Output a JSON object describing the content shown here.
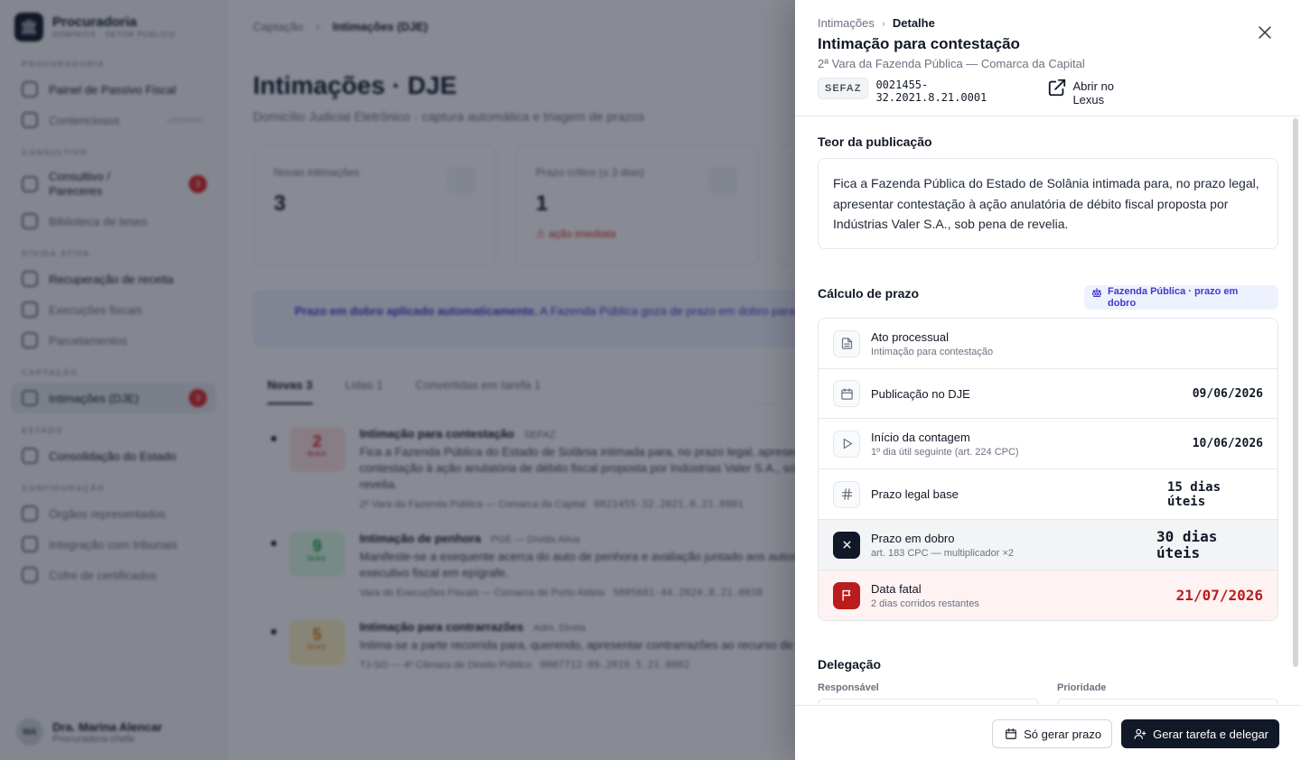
{
  "background": {
    "brand": {
      "title": "Procuradoria",
      "subtitle": "DOMÍNIOS · SETOR PÚBLICO"
    },
    "nav": {
      "procuradoria_label": "PROCURADORIA",
      "painel": "Painel de Passivo Fiscal",
      "contenciosos": "Contenciosos",
      "contenciosos_tag": "LEGADO",
      "consultivo_label": "CONSULTIVO",
      "consultivo": "Consultivo / Pareceres",
      "consultivo_badge": "3",
      "biblioteca": "Biblioteca de teses",
      "divida_label": "DÍVIDA ATIVA",
      "recuperacao": "Recuperação de receita",
      "execucoes": "Execuções fiscais",
      "parcelamentos": "Parcelamentos",
      "captacao_label": "CAPTAÇÃO",
      "intimacoes": "Intimações (DJE)",
      "intimacoes_badge": "3",
      "estado_label": "ESTADO",
      "consolidacao": "Consolidação do Estado",
      "config_label": "CONFIGURAÇÃO",
      "orgaos": "Órgãos representados",
      "integracao": "Integração com tribunais",
      "cofre": "Cofre de certificados"
    },
    "user": {
      "initials": "MA",
      "name": "Dra. Marina Alencar",
      "role": "Procuradora-chefe"
    },
    "breadcrumb": {
      "parent": "Captação",
      "current": "Intimações (DJE)"
    },
    "page_title": "Intimações · DJE",
    "page_subtitle": "Domicílio Judicial Eletrônico · captura automática e triagem de prazos",
    "cards": [
      {
        "label": "Novas intimações",
        "value": "3",
        "note": ""
      },
      {
        "label": "Prazo crítico (≤ 3 dias)",
        "value": "1",
        "note": "⚠ ação imediata"
      }
    ],
    "banner": {
      "strong": "Prazo em dobro aplicado automaticamente.",
      "text": "A Fazenda Pública goza de prazo em dobro para todas as suas manifestações processuais."
    },
    "tabs": [
      {
        "label": "Novas",
        "count": "3"
      },
      {
        "label": "Lidas",
        "count": "1"
      },
      {
        "label": "Convertidas em tarefa",
        "count": "1"
      }
    ],
    "rows": [
      {
        "days": "2",
        "unit": "DIAS",
        "title": "Intimação para contestação",
        "tag": "SEFAZ",
        "text": "Fica a Fazenda Pública do Estado de Solânia intimada para, no prazo legal, apresentar contestação à ação anulatória de débito fiscal proposta por Indústrias Valer S.A., sob pena de revelia.",
        "court": "2ª Vara da Fazenda Pública — Comarca da Capital",
        "number": "0021455-32.2021.8.21.0001",
        "color": "#fee2e2",
        "text_color": "#dc2626"
      },
      {
        "days": "9",
        "unit": "DIAS",
        "title": "Intimação de penhora",
        "tag": "PGE — Dívida Ativa",
        "text": "Manifeste-se a exequente acerca do auto de penhora e avaliação juntado aos autos do executivo fiscal em epígrafe.",
        "court": "Vara de Execuções Fiscais — Comarca de Porto Aldeia",
        "number": "5005601-44.2024.8.21.0038",
        "color": "#dcfce7",
        "text_color": "#16a34a"
      },
      {
        "days": "5",
        "unit": "DIAS",
        "title": "Intimação para contrarrazões",
        "tag": "Adm. Direta",
        "text": "Intima-se a parte recorrida para, querendo, apresentar contrarrazões ao recurso de apelação.",
        "court": "TJ-SO — 4ª Câmara de Direito Público",
        "number": "0007712-09.2019.5.21.0002",
        "color": "#fef3c7",
        "text_color": "#d97706"
      }
    ]
  },
  "drawer": {
    "breadcrumb": {
      "parent": "Intimações",
      "separator": "›",
      "current": "Detalhe"
    },
    "title": "Intimação para contestação",
    "subtitle": "2ª Vara da Fazenda Pública — Comarca da Capital",
    "chip": "SEFAZ",
    "process_number": "0021455-32.2021.8.21.0001",
    "open_lexus": "Abrir no Lexus",
    "teor": {
      "title": "Teor da publicação",
      "text": "Fica a Fazenda Pública do Estado de Solânia intimada para, no prazo legal, apresentar contestação à ação anulatória de débito fiscal proposta por Indústrias Valer S.A., sob pena de revelia."
    },
    "calc": {
      "title": "Cálculo de prazo",
      "pill": "Fazenda Pública · prazo em dobro",
      "rows": [
        {
          "icon": "document-icon",
          "label": "Ato processual",
          "note": "Intimação para contestação",
          "value": ""
        },
        {
          "icon": "calendar-icon",
          "label": "Publicação no DJE",
          "note": "",
          "value": "09/06/2026"
        },
        {
          "icon": "play-icon",
          "label": "Início da contagem",
          "note": "1º dia útil seguinte (art. 224 CPC)",
          "value": "10/06/2026"
        },
        {
          "icon": "hash-icon",
          "label": "Prazo legal base",
          "note": "",
          "value": "15 dias úteis"
        },
        {
          "icon": "multiply-icon",
          "label": "Prazo em dobro",
          "note": "art. 183 CPC — multiplicador ×2",
          "value": "30 dias úteis"
        },
        {
          "icon": "flag-icon",
          "label": "Data fatal",
          "note": "2 dias corridos restantes",
          "value": "21/07/2026"
        }
      ]
    },
    "delegacao": {
      "title": "Delegação",
      "responsavel_label": "Responsável",
      "prioridade_label": "Prioridade"
    },
    "footer": {
      "secondary": "Só gerar prazo",
      "primary": "Gerar tarefa e delegar"
    },
    "colors": {
      "accent": "#111827",
      "danger": "#b91c1c",
      "info": "#4338ca",
      "info_bg": "#eef2ff"
    }
  }
}
